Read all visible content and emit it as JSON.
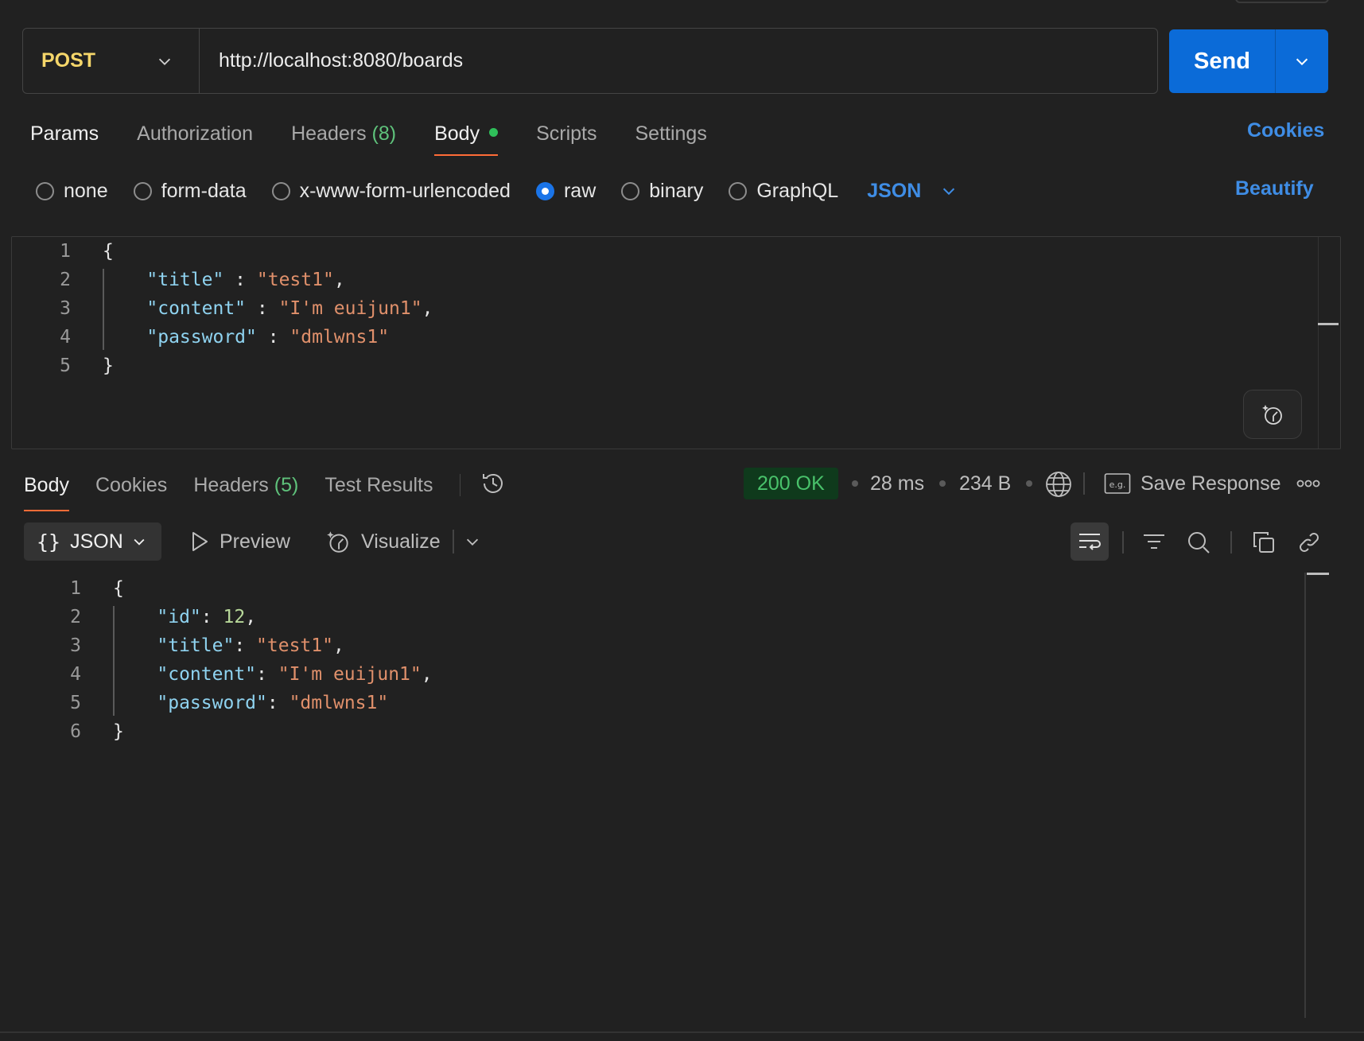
{
  "request": {
    "method": "POST",
    "url": "http://localhost:8080/boards",
    "send_label": "Send"
  },
  "request_tabs": {
    "params": "Params",
    "authorization": "Authorization",
    "headers": "Headers",
    "headers_count": "(8)",
    "body": "Body",
    "scripts": "Scripts",
    "settings": "Settings",
    "cookies": "Cookies"
  },
  "body_types": {
    "none": "none",
    "form_data": "form-data",
    "urlencoded": "x-www-form-urlencoded",
    "raw": "raw",
    "binary": "binary",
    "graphql": "GraphQL",
    "selected": "raw",
    "language": "JSON",
    "beautify": "Beautify"
  },
  "request_body": {
    "line_numbers": [
      "1",
      "2",
      "3",
      "4",
      "5"
    ],
    "open_brace": "{",
    "close_brace": "}",
    "fields": [
      {
        "key": "\"title\"",
        "sep": " : ",
        "value": "\"test1\"",
        "trail": ","
      },
      {
        "key": "\"content\"",
        "sep": " : ",
        "value": "\"I'm euijun1\"",
        "trail": ","
      },
      {
        "key": "\"password\"",
        "sep": " : ",
        "value": "\"dmlwns1\"",
        "trail": ""
      }
    ]
  },
  "response_tabs": {
    "body": "Body",
    "cookies": "Cookies",
    "headers": "Headers",
    "headers_count": "(5)",
    "test_results": "Test Results"
  },
  "response_meta": {
    "status": "200 OK",
    "time": "28 ms",
    "size": "234 B",
    "save_response": "Save Response",
    "status_color": "#49c26b"
  },
  "response_view": {
    "format": "JSON",
    "preview": "Preview",
    "visualize": "Visualize"
  },
  "response_body": {
    "line_numbers": [
      "1",
      "2",
      "3",
      "4",
      "5",
      "6"
    ],
    "open_brace": "{",
    "close_brace": "}",
    "id_key": "\"id\"",
    "id_value": "12",
    "fields": [
      {
        "key": "\"title\"",
        "sep": ": ",
        "value": "\"test1\"",
        "trail": ","
      },
      {
        "key": "\"content\"",
        "sep": ": ",
        "value": "\"I'm euijun1\"",
        "trail": ","
      },
      {
        "key": "\"password\"",
        "sep": ": ",
        "value": "\"dmlwns1\"",
        "trail": ""
      }
    ]
  },
  "icons": [
    "chevron-down-icon",
    "history-icon",
    "globe-icon",
    "save-response-icon",
    "more-icon",
    "preview-icon",
    "visualize-icon",
    "wrap-lines-icon",
    "filter-icon",
    "search-icon",
    "copy-icon",
    "link-icon",
    "ai-assist-icon"
  ],
  "colors": {
    "accent": "#0b6bd8",
    "method": "#f5d66a",
    "link": "#3f8de5",
    "tab_underline": "#ff6c37",
    "json_key": "#8fd3f0",
    "json_string": "#e0906b",
    "json_number": "#b8d99a"
  }
}
